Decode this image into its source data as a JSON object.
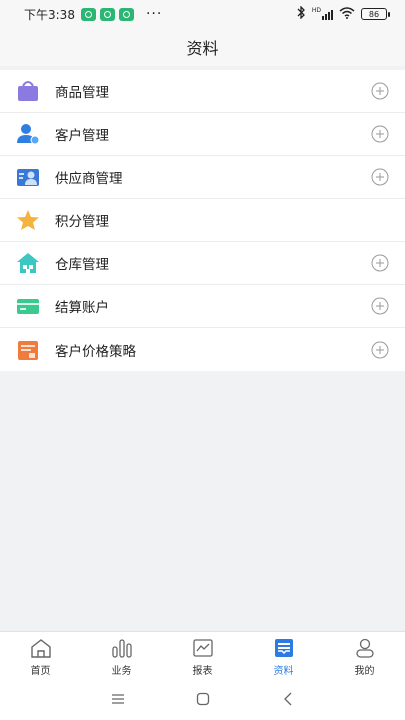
{
  "status_bar": {
    "time": "下午3:38",
    "more": "···",
    "network": "HD",
    "battery": "86"
  },
  "header": {
    "title": "资料"
  },
  "menu": [
    {
      "label": "商品管理",
      "icon": "shopping-bag-icon",
      "color": "#8b7ae0",
      "has_plus": true
    },
    {
      "label": "客户管理",
      "icon": "customer-icon",
      "color": "#2f7fe0",
      "has_plus": true
    },
    {
      "label": "供应商管理",
      "icon": "supplier-icon",
      "color": "#3a78d8",
      "has_plus": true
    },
    {
      "label": "积分管理",
      "icon": "star-icon",
      "color": "#f3b33d",
      "has_plus": false
    },
    {
      "label": "仓库管理",
      "icon": "warehouse-icon",
      "color": "#3cc8c0",
      "has_plus": true
    },
    {
      "label": "结算账户",
      "icon": "card-icon",
      "color": "#3ac98f",
      "has_plus": true
    },
    {
      "label": "客户价格策略",
      "icon": "price-list-icon",
      "color": "#f07b3f",
      "has_plus": true
    }
  ],
  "tabs": [
    {
      "label": "首页",
      "icon": "home-icon",
      "active": false
    },
    {
      "label": "业务",
      "icon": "bar-chart-icon",
      "active": false
    },
    {
      "label": "报表",
      "icon": "report-icon",
      "active": false
    },
    {
      "label": "资料",
      "icon": "data-icon",
      "active": true
    },
    {
      "label": "我的",
      "icon": "profile-icon",
      "active": false
    }
  ],
  "colors": {
    "accent": "#2c7be5",
    "tab_inactive": "#666666"
  }
}
